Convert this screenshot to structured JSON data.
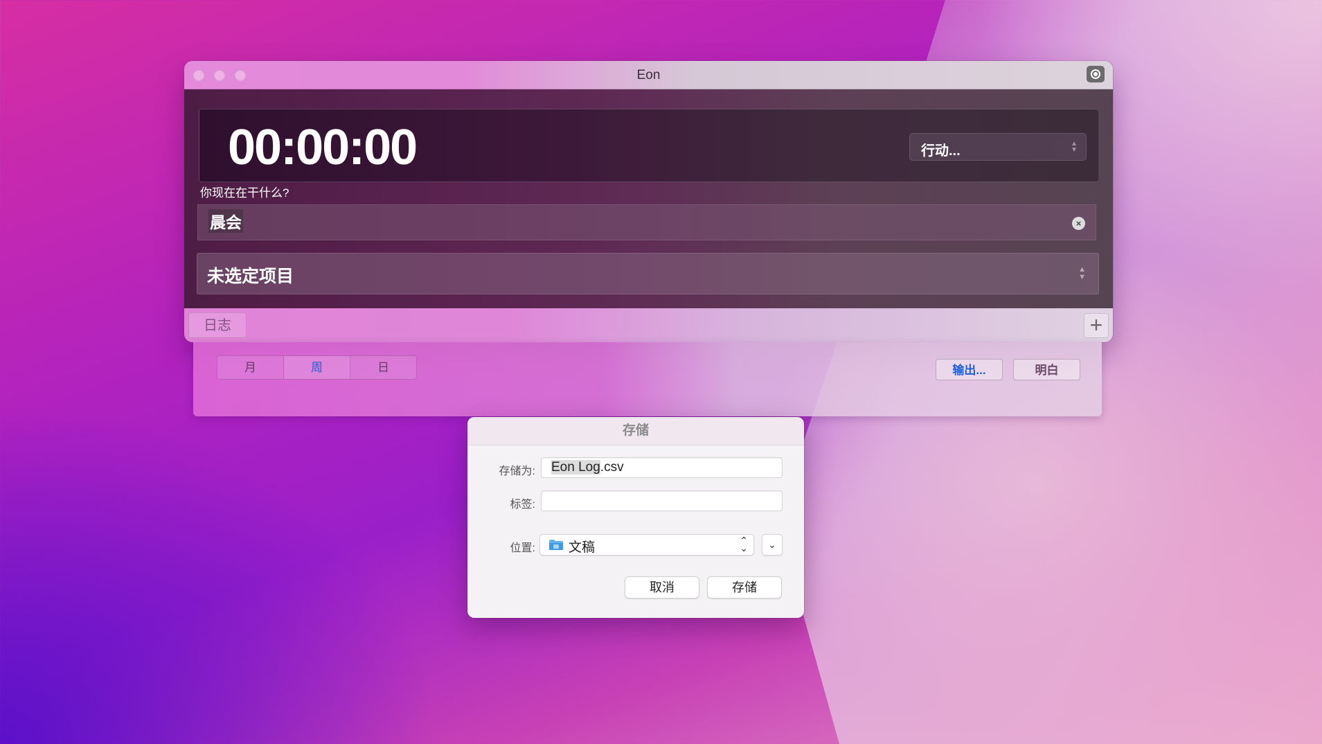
{
  "window": {
    "title": "Eon",
    "timer": "00:00:00",
    "action_select": "行动...",
    "question": "你现在在干什么?",
    "task_value": "晨会",
    "clear_icon": "×",
    "project_select": "未选定项目",
    "log_button": "日志",
    "add_icon": "+"
  },
  "log_panel": {
    "segments": [
      "月",
      "周",
      "日"
    ],
    "active_segment": "周",
    "export_button": "输出...",
    "tomorrow_button": "明白"
  },
  "save_dialog": {
    "title": "存储",
    "save_as_label": "存储为:",
    "filename_selected": "Eon Log",
    "filename_ext": ".csv",
    "tags_label": "标签:",
    "tags_value": "",
    "location_label": "位置:",
    "location_value": "文稿",
    "cancel_button": "取消",
    "save_button": "存储"
  },
  "icons": {
    "record": "record-icon",
    "folder": "folder-icon",
    "updown": "updown-chevron-icon",
    "expand": "chevron-down-icon"
  },
  "colors": {
    "accent_blue": "#1f5fd6",
    "timer_text": "#ffffff"
  }
}
